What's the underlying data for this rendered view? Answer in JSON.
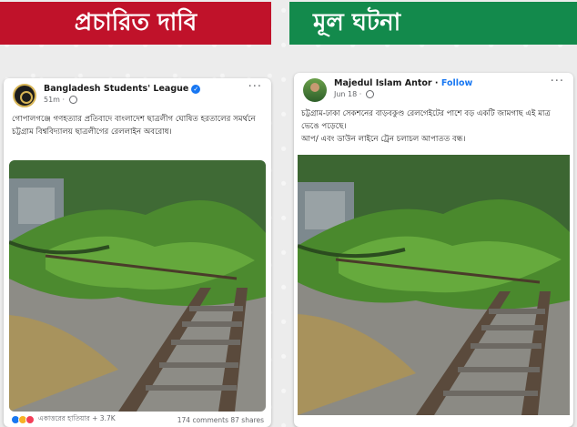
{
  "banners": {
    "claim": "প্রচারিত দাবি",
    "fact": "মূল ঘটনা"
  },
  "left_post": {
    "author": "Bangladesh Students' League",
    "time": "51m",
    "text": "গোপালগঞ্জে গণহত্যার প্রতিবাদে বাংলাদেশ ছাত্রলীগ ঘোষিত হরতালের সমর্থনে চট্টগ্রাম বিশ্ববিদ্যালয় ছাত্রলীগের রেললাইন অবরোধ।",
    "reactions_text": "একাত্তরের হাতিয়ার + 3.7K",
    "stats": "174 comments  87 shares",
    "more": "···"
  },
  "right_post": {
    "author": "Majedul Islam Antor",
    "follow": "Follow",
    "time": "Jun 18",
    "text": "চট্টগ্রাম-ঢাকা সেকশনের বাড়বকুণ্ড রেলগেইটের পাশে বড় একটি জামগাছ এই মাত্র ভেঙে পড়েছে।\nআপ/ এবং ডাউন লাইনে ট্রেন চলাচল  আপাতত বন্ধ।",
    "more": "···"
  },
  "colors": {
    "claim_banner": "#c0122a",
    "fact_banner": "#138a4c",
    "link_blue": "#1877f2"
  }
}
